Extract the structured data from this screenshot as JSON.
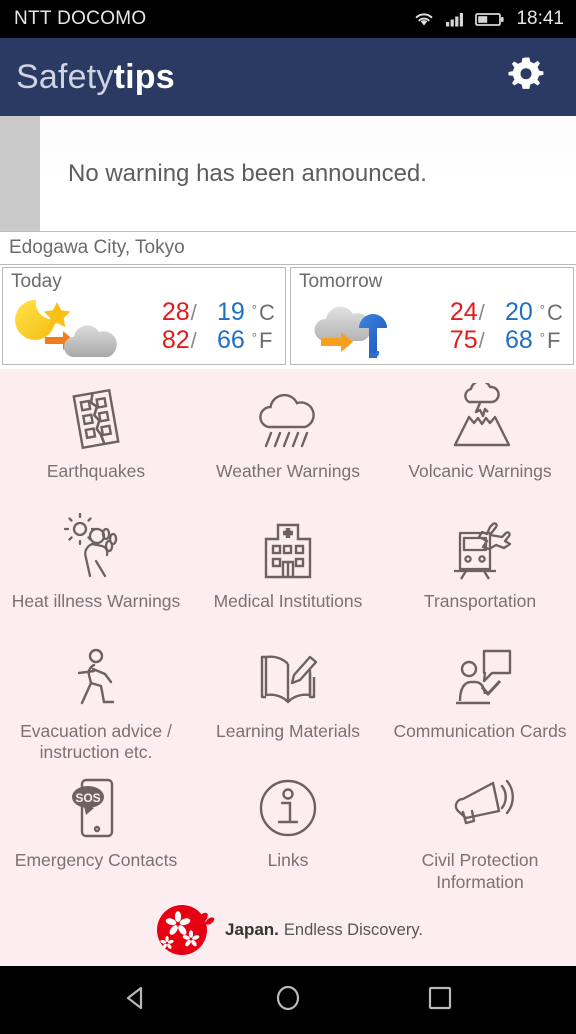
{
  "status_bar": {
    "carrier": "NTT DOCOMO",
    "time": "18:41",
    "icons": [
      "wifi-icon",
      "signal-icon",
      "battery-icon"
    ]
  },
  "app_bar": {
    "title_light": "Safety",
    "title_bold": "tips",
    "settings_icon": "gear-icon"
  },
  "warning": {
    "message": "No warning has been announced."
  },
  "location": {
    "name": "Edogawa City, Tokyo"
  },
  "weather": {
    "today": {
      "day_label": "Today",
      "icon": "moon-star-cloud-icon",
      "celsius_high": "28",
      "celsius_low": "19",
      "celsius_unit": "C",
      "fahrenheit_high": "82",
      "fahrenheit_low": "66",
      "fahrenheit_unit": "F",
      "separator": "/",
      "degree": "°"
    },
    "tomorrow": {
      "day_label": "Tomorrow",
      "icon": "cloud-umbrella-icon",
      "celsius_high": "24",
      "celsius_low": "20",
      "celsius_unit": "C",
      "fahrenheit_high": "75",
      "fahrenheit_low": "68",
      "fahrenheit_unit": "F",
      "separator": "/",
      "degree": "°"
    }
  },
  "menu": {
    "items": [
      {
        "label": "Earthquakes",
        "icon": "cracked-building-icon"
      },
      {
        "label": "Weather Warnings",
        "icon": "rain-cloud-icon"
      },
      {
        "label": "Volcanic Warnings",
        "icon": "volcano-icon"
      },
      {
        "label": "Heat illness Warnings",
        "icon": "sun-person-sweating-icon"
      },
      {
        "label": "Medical Institutions",
        "icon": "hospital-icon"
      },
      {
        "label": "Transportation",
        "icon": "train-plane-icon"
      },
      {
        "label": "Evacuation advice /\ninstruction etc.",
        "icon": "running-person-icon"
      },
      {
        "label": "Learning Materials",
        "icon": "open-book-pen-icon"
      },
      {
        "label": "Communication Cards",
        "icon": "person-speech-bubble-icon"
      },
      {
        "label": "Emergency Contacts",
        "icon": "phone-sos-icon"
      },
      {
        "label": "Links",
        "icon": "info-circle-icon"
      },
      {
        "label": "Civil Protection\nInformation",
        "icon": "megaphone-icon"
      }
    ]
  },
  "footer": {
    "logo_primary": "Japan.",
    "logo_secondary": "Endless Discovery.",
    "logo_icon": "japan-cherry-blossom-icon"
  },
  "nav_bar": {
    "back": "back-triangle-icon",
    "home": "home-circle-icon",
    "recents": "recents-square-icon"
  },
  "colors": {
    "header_navy": "#2b3a63",
    "grid_background": "#fcedf1",
    "temp_high": "#e01b1b",
    "temp_low": "#1f70c4",
    "label_gray": "#7c7072",
    "logo_red": "#e60012"
  }
}
